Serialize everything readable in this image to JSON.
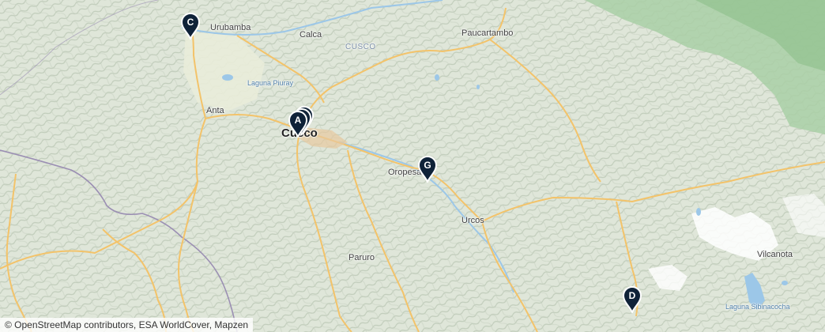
{
  "places": {
    "urubamba": "Urubamba",
    "calca": "Calca",
    "cusco_region": "CUSCO",
    "paucartambo": "Paucartambo",
    "laguna_piuray": "Laguna Piuray",
    "anta": "Anta",
    "cusco": "Cusco",
    "oropesa": "Oropesa",
    "urcos": "Urcos",
    "paruro": "Paruro",
    "vilcanota": "Vilcanota",
    "laguna_sibinacocha": "Laguna Sibinacocha"
  },
  "markers": [
    {
      "id": "A",
      "label": "A"
    },
    {
      "id": "C",
      "label": "C"
    },
    {
      "id": "G",
      "label": "G"
    },
    {
      "id": "D",
      "label": "D"
    }
  ],
  "attribution": "© OpenStreetMap contributors, ESA WorldCover, Mapzen",
  "colors": {
    "terrain": "#dfe6d9",
    "forest": "#a9cfa6",
    "snow": "#ffffff",
    "road": "#f3c36a",
    "water": "#9cc7e8",
    "marker": "#0f2238",
    "border": "#9b8fb3"
  }
}
